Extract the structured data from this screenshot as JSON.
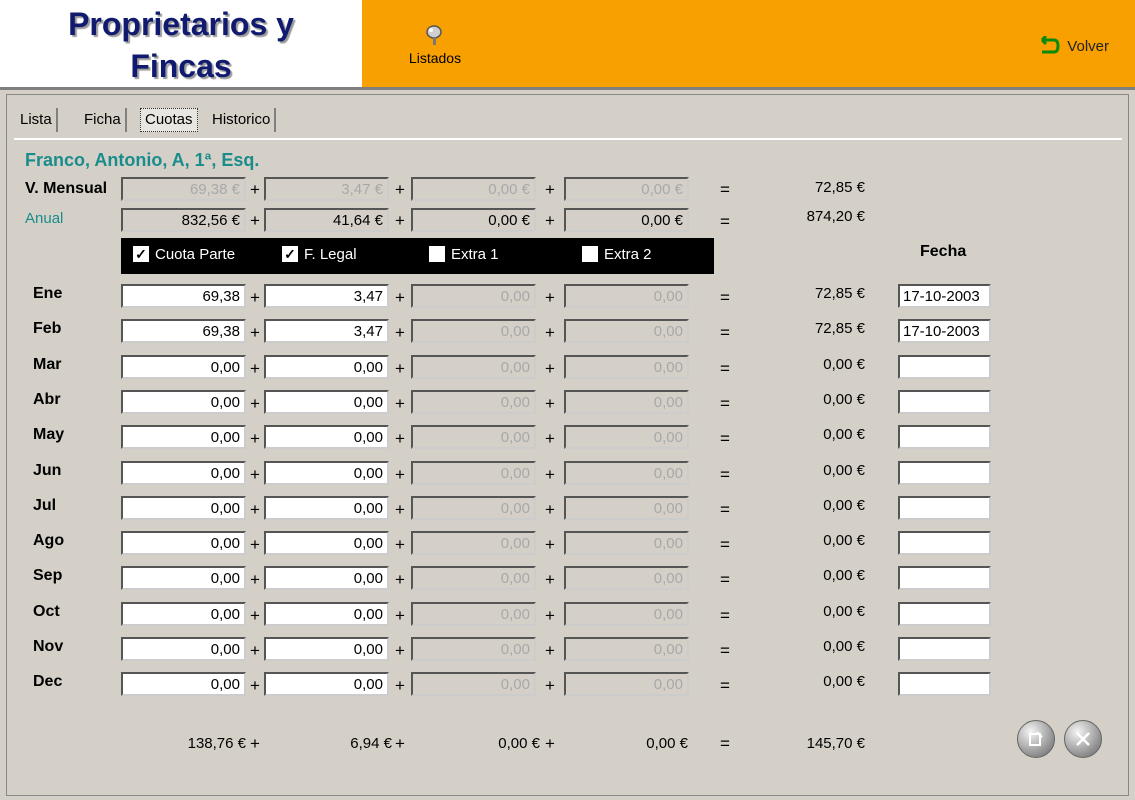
{
  "header": {
    "logo_line1": "Proprietarios y",
    "logo_line2": "Fincas",
    "listados_label": "Listados",
    "volver_label": "Volver",
    "listados_icon": "broom-icon",
    "volver_icon": "back-arrow-icon",
    "accent_color": "#f7a000"
  },
  "tabs": [
    "Lista",
    "Ficha",
    "Cuotas",
    "Historico"
  ],
  "active_tab": "Cuotas",
  "owner": "Franco, Antonio, A, 1ª, Esq.",
  "mensual": {
    "label": "V. Mensual",
    "values": [
      "69,38 €",
      "3,47 €",
      "0,00 €",
      "0,00 €"
    ],
    "total": "72,85 €"
  },
  "anual": {
    "label": "Anual",
    "values": [
      "832,56 €",
      "41,64 €",
      "0,00 €",
      "0,00 €"
    ],
    "total": "874,20 €"
  },
  "checks": [
    {
      "label": "Cuota Parte",
      "checked": true
    },
    {
      "label": "F. Legal",
      "checked": true
    },
    {
      "label": "Extra 1",
      "checked": false
    },
    {
      "label": "Extra 2",
      "checked": false
    }
  ],
  "fecha_header": "Fecha",
  "months": [
    {
      "name": "Ene",
      "v1": "69,38",
      "v2": "3,47",
      "v3": "0,00",
      "v4": "0,00",
      "total": "72,85 €",
      "fecha": "17-10-2003"
    },
    {
      "name": "Feb",
      "v1": "69,38",
      "v2": "3,47",
      "v3": "0,00",
      "v4": "0,00",
      "total": "72,85 €",
      "fecha": "17-10-2003"
    },
    {
      "name": "Mar",
      "v1": "0,00",
      "v2": "0,00",
      "v3": "0,00",
      "v4": "0,00",
      "total": "0,00 €",
      "fecha": ""
    },
    {
      "name": "Abr",
      "v1": "0,00",
      "v2": "0,00",
      "v3": "0,00",
      "v4": "0,00",
      "total": "0,00 €",
      "fecha": ""
    },
    {
      "name": "May",
      "v1": "0,00",
      "v2": "0,00",
      "v3": "0,00",
      "v4": "0,00",
      "total": "0,00 €",
      "fecha": ""
    },
    {
      "name": "Jun",
      "v1": "0,00",
      "v2": "0,00",
      "v3": "0,00",
      "v4": "0,00",
      "total": "0,00 €",
      "fecha": ""
    },
    {
      "name": "Jul",
      "v1": "0,00",
      "v2": "0,00",
      "v3": "0,00",
      "v4": "0,00",
      "total": "0,00 €",
      "fecha": ""
    },
    {
      "name": "Ago",
      "v1": "0,00",
      "v2": "0,00",
      "v3": "0,00",
      "v4": "0,00",
      "total": "0,00 €",
      "fecha": ""
    },
    {
      "name": "Sep",
      "v1": "0,00",
      "v2": "0,00",
      "v3": "0,00",
      "v4": "0,00",
      "total": "0,00 €",
      "fecha": ""
    },
    {
      "name": "Oct",
      "v1": "0,00",
      "v2": "0,00",
      "v3": "0,00",
      "v4": "0,00",
      "total": "0,00 €",
      "fecha": ""
    },
    {
      "name": "Nov",
      "v1": "0,00",
      "v2": "0,00",
      "v3": "0,00",
      "v4": "0,00",
      "total": "0,00 €",
      "fecha": ""
    },
    {
      "name": "Dec",
      "v1": "0,00",
      "v2": "0,00",
      "v3": "0,00",
      "v4": "0,00",
      "total": "0,00 €",
      "fecha": ""
    }
  ],
  "footer": {
    "t1": "138,76 €",
    "t2": "6,94 €",
    "t3": "0,00 €",
    "t4": "0,00 €",
    "total": "145,70 €",
    "edit_icon": "edit-icon",
    "tools_icon": "tools-icon"
  },
  "ops": {
    "plus": "+",
    "equals": "="
  }
}
